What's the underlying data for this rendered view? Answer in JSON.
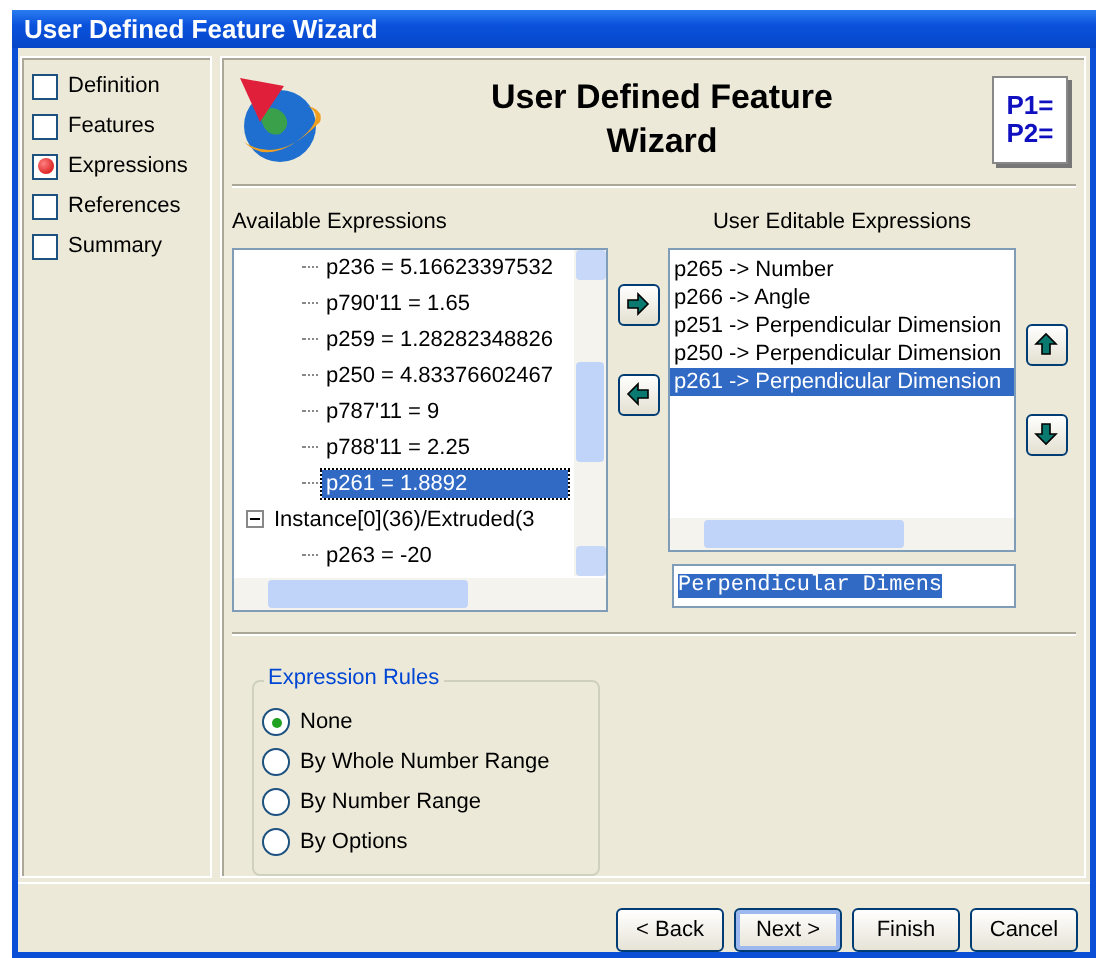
{
  "window": {
    "title": "User Defined Feature Wizard"
  },
  "steps": [
    {
      "label": "Definition",
      "current": false
    },
    {
      "label": "Features",
      "current": false
    },
    {
      "label": "Expressions",
      "current": true
    },
    {
      "label": "References",
      "current": false
    },
    {
      "label": "Summary",
      "current": false
    }
  ],
  "header": {
    "title": "User Defined Feature Wizard",
    "badge_lines": [
      "P1=",
      "P2="
    ]
  },
  "available": {
    "label": "Available Expressions",
    "items": [
      {
        "label": "p236 = 5.16623397532",
        "selected": false
      },
      {
        "label": "p790'11 = 1.65",
        "selected": false
      },
      {
        "label": "p259 = 1.28282348826",
        "selected": false
      },
      {
        "label": "p250 = 4.83376602467",
        "selected": false
      },
      {
        "label": "p787'11 = 9",
        "selected": false
      },
      {
        "label": "p788'11 = 2.25",
        "selected": false
      },
      {
        "label": "p261 = 1.8892",
        "selected": true
      }
    ],
    "nodes": [
      {
        "label": "Instance[0](36)/Extruded(3",
        "expanded": true,
        "children": [
          {
            "label": "p263 = -20",
            "selected": false
          }
        ]
      }
    ]
  },
  "editable": {
    "label": "User Editable Expressions",
    "items": [
      {
        "label": "p265 -> Number",
        "selected": false
      },
      {
        "label": "p266 -> Angle",
        "selected": false
      },
      {
        "label": "p251 -> Perpendicular Dimension",
        "selected": false
      },
      {
        "label": "p250 -> Perpendicular Dimension",
        "selected": false
      },
      {
        "label": "p261 -> Perpendicular Dimension",
        "selected": true
      }
    ],
    "value": "Perpendicular Dimens"
  },
  "rules": {
    "title": "Expression Rules",
    "options": [
      {
        "label": "None",
        "selected": true
      },
      {
        "label": "By Whole Number Range",
        "selected": false
      },
      {
        "label": "By Number Range",
        "selected": false
      },
      {
        "label": "By Options",
        "selected": false
      }
    ]
  },
  "buttons": [
    {
      "label": "< Back",
      "focused": false
    },
    {
      "label": "Next >",
      "focused": true
    },
    {
      "label": "Finish",
      "focused": false
    },
    {
      "label": "Cancel",
      "focused": false
    }
  ]
}
